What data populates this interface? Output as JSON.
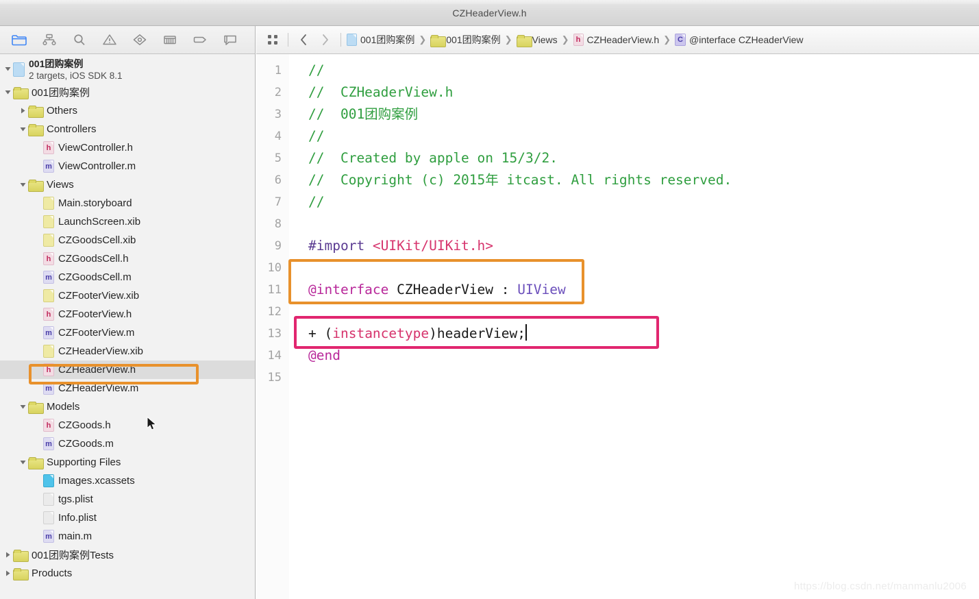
{
  "window": {
    "title": "CZHeaderView.h"
  },
  "navigator": {
    "toolbar_icons": [
      {
        "name": "project-navigator-icon",
        "label": "Project Navigator",
        "selected": true
      },
      {
        "name": "source-control-navigator-icon",
        "label": "Source Control Navigator",
        "selected": false
      },
      {
        "name": "search-navigator-icon",
        "label": "Find Navigator",
        "selected": false
      },
      {
        "name": "issue-navigator-icon",
        "label": "Issue Navigator",
        "selected": false
      },
      {
        "name": "test-navigator-icon",
        "label": "Test Navigator",
        "selected": false
      },
      {
        "name": "debug-navigator-icon",
        "label": "Debug Navigator",
        "selected": false
      },
      {
        "name": "breakpoint-navigator-icon",
        "label": "Breakpoint Navigator",
        "selected": false
      },
      {
        "name": "report-navigator-icon",
        "label": "Report Navigator",
        "selected": false
      }
    ],
    "project": {
      "name": "001团购案例",
      "subtitle": "2 targets, iOS SDK 8.1",
      "icon": "xcodeproj-icon"
    },
    "tree": [
      {
        "id": "grp-root",
        "label": "001团购案例",
        "kind": "folder",
        "depth": 1,
        "expanded": true,
        "selected": false
      },
      {
        "id": "grp-others",
        "label": "Others",
        "kind": "folder",
        "depth": 2,
        "expanded": false,
        "selected": false
      },
      {
        "id": "grp-ctrl",
        "label": "Controllers",
        "kind": "folder",
        "depth": 2,
        "expanded": true,
        "selected": false
      },
      {
        "id": "f-vc-h",
        "label": "ViewController.h",
        "kind": "h",
        "depth": 3,
        "selected": false
      },
      {
        "id": "f-vc-m",
        "label": "ViewController.m",
        "kind": "m",
        "depth": 3,
        "selected": false
      },
      {
        "id": "grp-views",
        "label": "Views",
        "kind": "folder",
        "depth": 2,
        "expanded": true,
        "selected": false
      },
      {
        "id": "f-main-sb",
        "label": "Main.storyboard",
        "kind": "storyboard",
        "depth": 3,
        "selected": false
      },
      {
        "id": "f-launch",
        "label": "LaunchScreen.xib",
        "kind": "xib",
        "depth": 3,
        "selected": false
      },
      {
        "id": "f-goodscell-x",
        "label": "CZGoodsCell.xib",
        "kind": "xib",
        "depth": 3,
        "selected": false
      },
      {
        "id": "f-goodscell-h",
        "label": "CZGoodsCell.h",
        "kind": "h",
        "depth": 3,
        "selected": false
      },
      {
        "id": "f-goodscell-m",
        "label": "CZGoodsCell.m",
        "kind": "m",
        "depth": 3,
        "selected": false
      },
      {
        "id": "f-footer-x",
        "label": "CZFooterView.xib",
        "kind": "xib",
        "depth": 3,
        "selected": false
      },
      {
        "id": "f-footer-h",
        "label": "CZFooterView.h",
        "kind": "h",
        "depth": 3,
        "selected": false
      },
      {
        "id": "f-footer-m",
        "label": "CZFooterView.m",
        "kind": "m",
        "depth": 3,
        "selected": false
      },
      {
        "id": "f-header-x",
        "label": "CZHeaderView.xib",
        "kind": "xib",
        "depth": 3,
        "selected": false
      },
      {
        "id": "f-header-h",
        "label": "CZHeaderView.h",
        "kind": "h",
        "depth": 3,
        "selected": true
      },
      {
        "id": "f-header-m",
        "label": "CZHeaderView.m",
        "kind": "m",
        "depth": 3,
        "selected": false
      },
      {
        "id": "grp-models",
        "label": "Models",
        "kind": "folder",
        "depth": 2,
        "expanded": true,
        "selected": false
      },
      {
        "id": "f-goods-h",
        "label": "CZGoods.h",
        "kind": "h",
        "depth": 3,
        "selected": false
      },
      {
        "id": "f-goods-m",
        "label": "CZGoods.m",
        "kind": "m",
        "depth": 3,
        "selected": false
      },
      {
        "id": "grp-support",
        "label": "Supporting Files",
        "kind": "folder",
        "depth": 2,
        "expanded": true,
        "selected": false
      },
      {
        "id": "f-assets",
        "label": "Images.xcassets",
        "kind": "xcassets",
        "depth": 3,
        "selected": false
      },
      {
        "id": "f-tgs",
        "label": "tgs.plist",
        "kind": "plist",
        "depth": 3,
        "selected": false
      },
      {
        "id": "f-info",
        "label": "Info.plist",
        "kind": "plist",
        "depth": 3,
        "selected": false
      },
      {
        "id": "f-mainm",
        "label": "main.m",
        "kind": "m",
        "depth": 3,
        "selected": false
      },
      {
        "id": "grp-tests",
        "label": "001团购案例Tests",
        "kind": "folder",
        "depth": 1,
        "expanded": false,
        "selected": false
      },
      {
        "id": "grp-products",
        "label": "Products",
        "kind": "folder",
        "depth": 1,
        "expanded": false,
        "selected": false
      }
    ]
  },
  "editor": {
    "jump_bar": {
      "related_items_label": "Related Items",
      "back_label": "Back",
      "forward_label": "Forward",
      "breadcrumbs": [
        {
          "label": "001团购案例",
          "icon": "xcodeproj-icon"
        },
        {
          "label": "001团购案例",
          "icon": "folder-icon"
        },
        {
          "label": "Views",
          "icon": "folder-icon"
        },
        {
          "label": "CZHeaderView.h",
          "icon": "header-file-icon"
        },
        {
          "label": "@interface CZHeaderView",
          "icon": "class-symbol-icon"
        }
      ]
    },
    "code_lines": [
      {
        "n": "1",
        "tokens": [
          {
            "t": "//",
            "c": "comment"
          }
        ]
      },
      {
        "n": "2",
        "tokens": [
          {
            "t": "//  CZHeaderView.h",
            "c": "comment"
          }
        ]
      },
      {
        "n": "3",
        "tokens": [
          {
            "t": "//  001团购案例",
            "c": "comment"
          }
        ]
      },
      {
        "n": "4",
        "tokens": [
          {
            "t": "//",
            "c": "comment"
          }
        ]
      },
      {
        "n": "5",
        "tokens": [
          {
            "t": "//  Created by apple on 15/3/2.",
            "c": "comment"
          }
        ]
      },
      {
        "n": "6",
        "tokens": [
          {
            "t": "//  Copyright (c) 2015年 itcast. All rights reserved.",
            "c": "comment"
          }
        ]
      },
      {
        "n": "7",
        "tokens": [
          {
            "t": "//",
            "c": "comment"
          }
        ]
      },
      {
        "n": "8",
        "tokens": []
      },
      {
        "n": "9",
        "tokens": [
          {
            "t": "#import ",
            "c": "pre"
          },
          {
            "t": "<UIKit/UIKit.h>",
            "c": "string"
          }
        ]
      },
      {
        "n": "10",
        "tokens": []
      },
      {
        "n": "11",
        "tokens": [
          {
            "t": "@interface",
            "c": "keyword"
          },
          {
            "t": " CZHeaderView : ",
            "c": "plain"
          },
          {
            "t": "UIView",
            "c": "type"
          }
        ]
      },
      {
        "n": "12",
        "tokens": []
      },
      {
        "n": "13",
        "tokens": [
          {
            "t": "+ (",
            "c": "plain"
          },
          {
            "t": "instancetype",
            "c": "string"
          },
          {
            "t": ")headerView;",
            "c": "plain"
          }
        ],
        "caret": true
      },
      {
        "n": "14",
        "tokens": [
          {
            "t": "@end",
            "c": "keyword"
          }
        ]
      },
      {
        "n": "15",
        "tokens": []
      }
    ]
  },
  "annotations": {
    "orange_boxes": [
      {
        "name": "highlight-interface-line",
        "target": "@interface CZHeaderView :"
      },
      {
        "name": "highlight-sidebar-header-file",
        "target": "CZHeaderView.h"
      }
    ],
    "pink_boxes": [
      {
        "name": "highlight-classmethod-line",
        "target": "+ (instancetype)headerView;"
      }
    ],
    "colors": {
      "orange": "#e8912c",
      "pink": "#e1266f",
      "comment_green": "#2f9e3f",
      "keyword_magenta": "#b8289a",
      "type_purple": "#6b4fbb",
      "string_pink": "#d6336c",
      "preproc_purple": "#5b3b92",
      "accent_blue": "#3f86f5"
    }
  },
  "watermark": {
    "text": "https://blog.csdn.net/manmanlu2006"
  }
}
